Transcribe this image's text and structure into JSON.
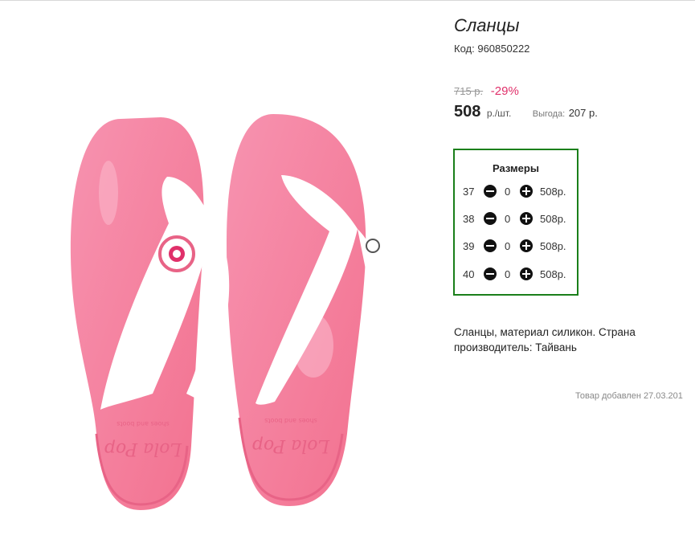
{
  "product": {
    "title": "Сланцы",
    "code_label": "Код:",
    "code": "960850222",
    "old_price": "715 р.",
    "discount": "-29%",
    "price": "508",
    "price_unit": "р./шт.",
    "savings_label": "Выгода:",
    "savings": "207 р.",
    "description": "Сланцы, материал силикон. Страна производитель: Тайвань",
    "added_label": "Товар добавлен 27.03.201"
  },
  "sizes": {
    "title": "Размеры",
    "rows": [
      {
        "size": "37",
        "qty": "0",
        "price": "508р."
      },
      {
        "size": "38",
        "qty": "0",
        "price": "508р."
      },
      {
        "size": "39",
        "qty": "0",
        "price": "508р."
      },
      {
        "size": "40",
        "qty": "0",
        "price": "508р."
      }
    ]
  },
  "image": {
    "brand_text": "Lola Pop",
    "brand_subtext": "shoes and boots",
    "colors": {
      "sole": "#f47a9c",
      "sole_light": "#f7a6be",
      "strap": "#ffffff",
      "accent": "#e0306a"
    }
  },
  "colors": {
    "sizes_border": "#1a7f1a",
    "discount": "#e0306a"
  }
}
